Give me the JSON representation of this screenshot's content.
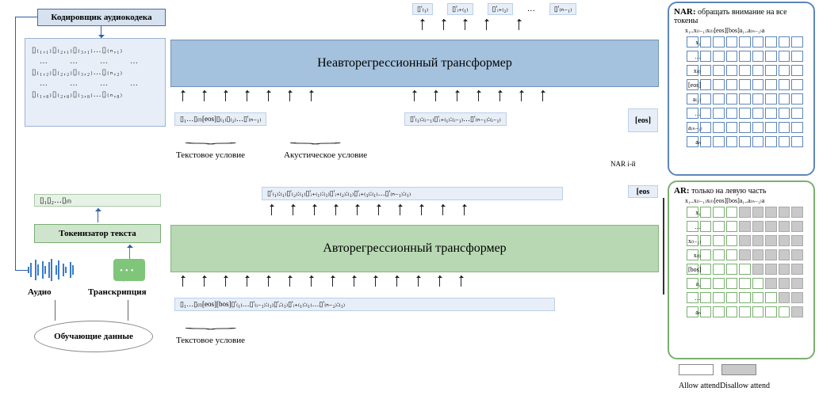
{
  "left": {
    "encoder_label": "Кодировщик аудиокодека",
    "codec_rows": [
      "▯₍₁,₁₎▯₍₂,₁₎▯₍₃,₁₎…▯₍ₙ,₁₎",
      "▯₍₁,₂₎▯₍₂,₂₎▯₍₃,₂₎…▯₍ₙ,₂₎",
      "▯₍₁,₈₎▯₍₂,₈₎▯₍₃,₈₎…▯₍ₙ,₈₎"
    ],
    "tokenizer_label": "Токенизатор текста",
    "tokenizer_out": "▯₁▯₂…▯₍ₗ₎",
    "audio_label": "Аудио",
    "transcription_label": "Транскрипция",
    "training_data_label": "Обучающие данные"
  },
  "center": {
    "nar": {
      "title": "Неавторегрессионный трансформер",
      "outputs": [
        "▯'₍₁₎",
        "▯'ᵢ₊₍₁₎",
        "▯'ᵢ₊₍₂₎",
        "…",
        "▯'₍ₙ₋₁₎"
      ],
      "input_left": "▯₁…▯₍ₗ₎[eos]▯₍₁₎▯₍₂₎…▯'₍ₙ₋₁₎",
      "input_right": "▯'₍₁₎:₍ᵢ₋₁₎▯'ᵢ₊₍₁₎:₍ᵢ₋₁₎…▯'₍ₙ₋₁₎:₍ᵢ₋₁₎",
      "eos": "[eos]",
      "cond_text": "Текстовое условие",
      "cond_acoustic": "Акустическое условие",
      "stage_label": "NAR i-й"
    },
    "ar": {
      "title": "Авторегрессионный трансформер",
      "outputs": "▯'₍₁₎:₍₁₎▯'₍₂₎:₍₁₎▯'ᵢ₊₍₁₎:₍₁₎▯'ᵢ₊₍₂₎:₍₁₎▯'ᵢ₊₍₃₎:₍₁₎…▯'₍ₙ₋₁₎:₍₁₎",
      "eos": "[eos",
      "inputs": "▯₁…▯₍ₗ₎[eos][bos]▯'₍₁₎…▯'₍ᵢ₋₁₎:₍₁₎▯'ᵢ:₍₁₎▯'ᵢ₊₍₁₎:₍₁₎…▯'₍ₙ₋₂₎:₍₁₎",
      "cond_text": "Текстовое условие"
    }
  },
  "masks": {
    "nar": {
      "title_prefix": "NAR:",
      "title": "обращать внимание на все токены",
      "axis": "x₁..x₍ₗ₋₁₎x₍ₗ₎[eos][bos]a₁..a₍ₙ₋₁₎a",
      "rows": [
        "x₁",
        "…",
        "x₍ₗ₎",
        "[eos]",
        "a₍₁₎",
        "…",
        "a₍ₙ₋₁₎",
        "aₙ"
      ],
      "cols": 9
    },
    "ar": {
      "title_prefix": "AR:",
      "title": "только на левую часть",
      "axis": "x₁..x₍ₗ₋₁₎x₍ₗ₎[eos][bos]a₁..a₍ₙ₋₁₎a",
      "rows": [
        "x₁",
        "…",
        "x₍ₗ₋₁₎",
        "x₍ₗ₎",
        "[bos]",
        "a₁",
        "…",
        "aₙ"
      ],
      "cols": 9,
      "lower_triangular_from_row": 4
    },
    "legend_allow": "Allow attend",
    "legend_disallow": "Disallow attend"
  },
  "chart_data": {
    "type": "diagram",
    "components": [
      {
        "id": "training-data",
        "label": "Обучающие данные",
        "outputs": [
          "audio",
          "transcription"
        ]
      },
      {
        "id": "audio",
        "label": "Аудио"
      },
      {
        "id": "transcription",
        "label": "Транскрипция"
      },
      {
        "id": "audio-codec-encoder",
        "label": "Кодировщик аудиокодека",
        "input": "audio",
        "output": "codec-tokens"
      },
      {
        "id": "text-tokenizer",
        "label": "Токенизатор текста",
        "input": "transcription",
        "output": "text-tokens"
      },
      {
        "id": "ar-transformer",
        "label": "Авторегрессионный трансформер",
        "inputs": [
          "text-tokens",
          "[eos]",
          "[bos]",
          "prev-acoustic-level1"
        ],
        "outputs": [
          "acoustic-level1",
          "[eos]"
        ],
        "attention_mask": "causal"
      },
      {
        "id": "nar-transformer",
        "label": "Неавторегрессионный трансформер",
        "inputs": [
          "text-tokens",
          "[eos]",
          "acoustic-levels<j"
        ],
        "outputs": [
          "acoustic-level-j"
        ],
        "condition_labels": [
          "Текстовое условие",
          "Акустическое условие"
        ],
        "attention_mask": "full"
      }
    ],
    "attention_masks": {
      "NAR": {
        "rows": 8,
        "cols": 9,
        "pattern": "all-ones"
      },
      "AR": {
        "rows": 8,
        "cols": 9,
        "pattern": "rows 0-3 full; rows 4-7 lower-triangular starting col=row"
      }
    }
  }
}
